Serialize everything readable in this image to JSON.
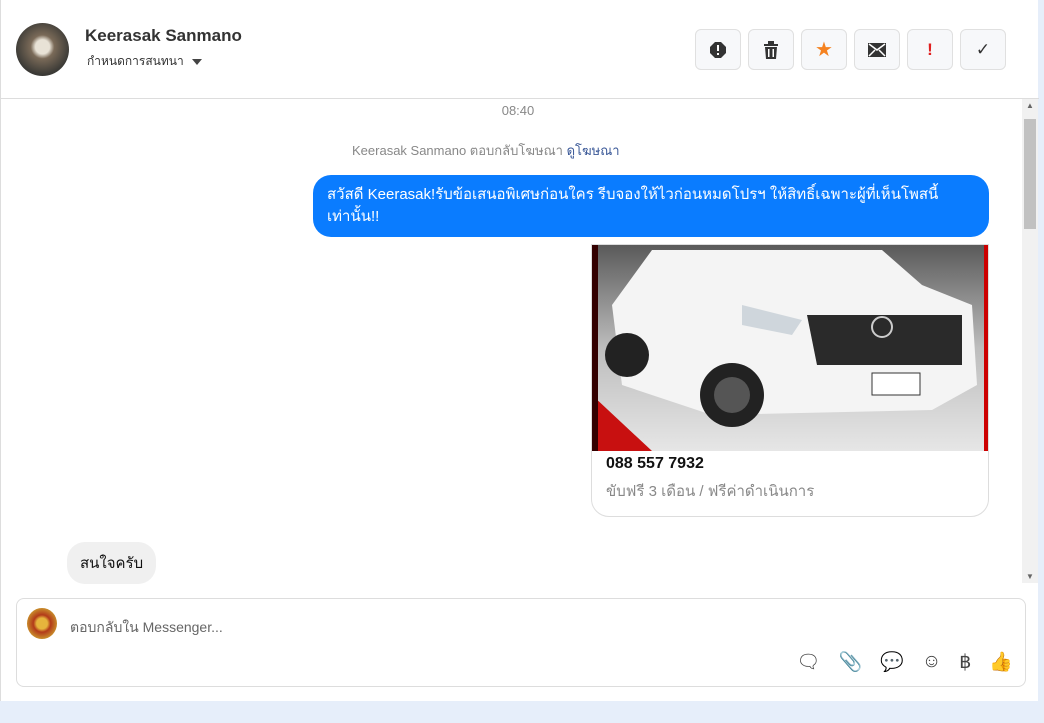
{
  "header": {
    "name": "Keerasak Sanmano",
    "subtitle": "กำหนดการสนทนา",
    "actions": [
      {
        "icon": "alert-octagon-icon",
        "glyph": "⬢"
      },
      {
        "icon": "trash-icon",
        "glyph": "🗑"
      },
      {
        "icon": "star-icon",
        "glyph": "★",
        "color": "#f58220"
      },
      {
        "icon": "envelope-icon",
        "glyph": "✉"
      },
      {
        "icon": "exclamation-icon",
        "glyph": "!",
        "color": "#e02020"
      },
      {
        "icon": "check-icon",
        "glyph": "✓"
      }
    ]
  },
  "messages": {
    "time": "08:40",
    "reply_note": "Keerasak Sanmano ตอบกลับโฆษณา",
    "reply_link": "ดูโฆษณา",
    "outgoing": "สวัสดี Keerasak!รับข้อเสนอพิเศษก่อนใคร รีบจองให้ไวก่อนหมดโปรฯ ให้สิทธิ์เฉพาะผู้ที่เห็นโพสนี้เท่านั้น!!",
    "card_phone": "088 557 7932",
    "card_desc": "ขับฟรี 3 เดือน / ฟรีค่าดำเนินการ",
    "incoming": "สนใจครับ"
  },
  "composer": {
    "placeholder": "ตอบกลับใน Messenger...",
    "tools": [
      "saved-reply-icon",
      "attach-icon",
      "chat-icon",
      "emoji-icon",
      "baht-icon",
      "thumbs-up-icon"
    ]
  },
  "colors": {
    "accent": "#0a7cff"
  }
}
